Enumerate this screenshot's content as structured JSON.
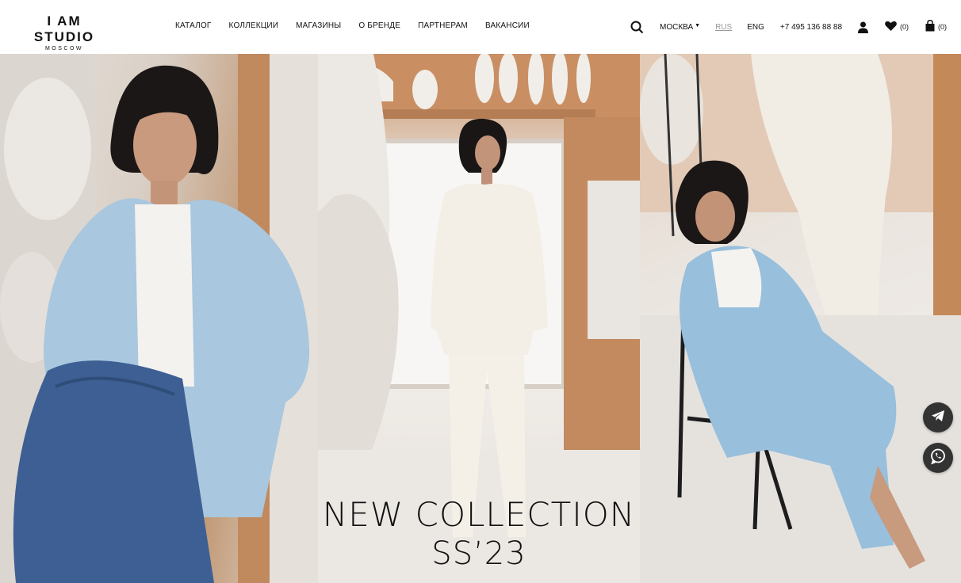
{
  "brand": {
    "name": "I AM STUDIO",
    "sub": "MOSCOW"
  },
  "nav": [
    "КАТАЛОГ",
    "КОЛЛЕКЦИИ",
    "МАГАЗИНЫ",
    "О БРЕНДЕ",
    "ПАРТНЕРАМ",
    "ВАКАНСИИ"
  ],
  "header": {
    "city": "МОСКВА",
    "lang_active": "RUS",
    "lang_other": "ENG",
    "phone": "+7 495 136 88 88",
    "wishlist_count": "(0)",
    "cart_count": "(0)"
  },
  "hero": {
    "line1": "NEW COLLECTION",
    "line2": "SS’23"
  },
  "icons": [
    "search-icon",
    "user-icon",
    "heart-icon",
    "bag-icon",
    "telegram-icon",
    "whatsapp-icon"
  ],
  "colors": {
    "text": "#111111",
    "muted": "#999999",
    "float_button": "#333333"
  }
}
